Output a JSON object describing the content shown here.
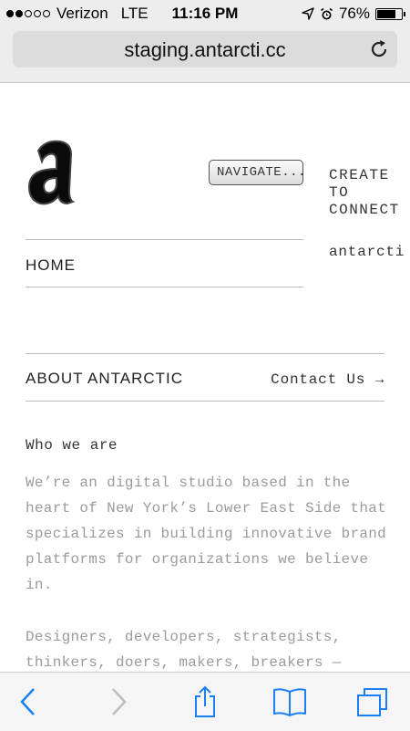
{
  "status_bar": {
    "carrier": "Verizon",
    "network": "LTE",
    "time": "11:16 PM",
    "battery": "76%",
    "battery_level": 0.76
  },
  "browser": {
    "url": "staging.antarcti.cc"
  },
  "site": {
    "logo_alt": "a",
    "nav_button": "NAVIGATE...",
    "tagline": "CREATE\nTO\nCONNECT",
    "handle": "antarcti",
    "nav_home": "HOME",
    "section_title": "ABOUT ANTARCTIC",
    "contact_link": "Contact Us →",
    "subheading": "Who we are",
    "paragraph1": "We’re an digital studio based in the heart of New York’s Lower East Side that specializes in building innovative brand platforms for organizations we believe in.",
    "paragraph2": "Designers, developers, strategists, thinkers, doers, makers, breakers —"
  },
  "toolbar": {
    "icons": [
      "back-icon",
      "forward-icon",
      "share-icon",
      "bookmarks-icon",
      "tabs-icon"
    ],
    "accent": "#1a7ef5",
    "disabled": "#bdbdbd"
  }
}
